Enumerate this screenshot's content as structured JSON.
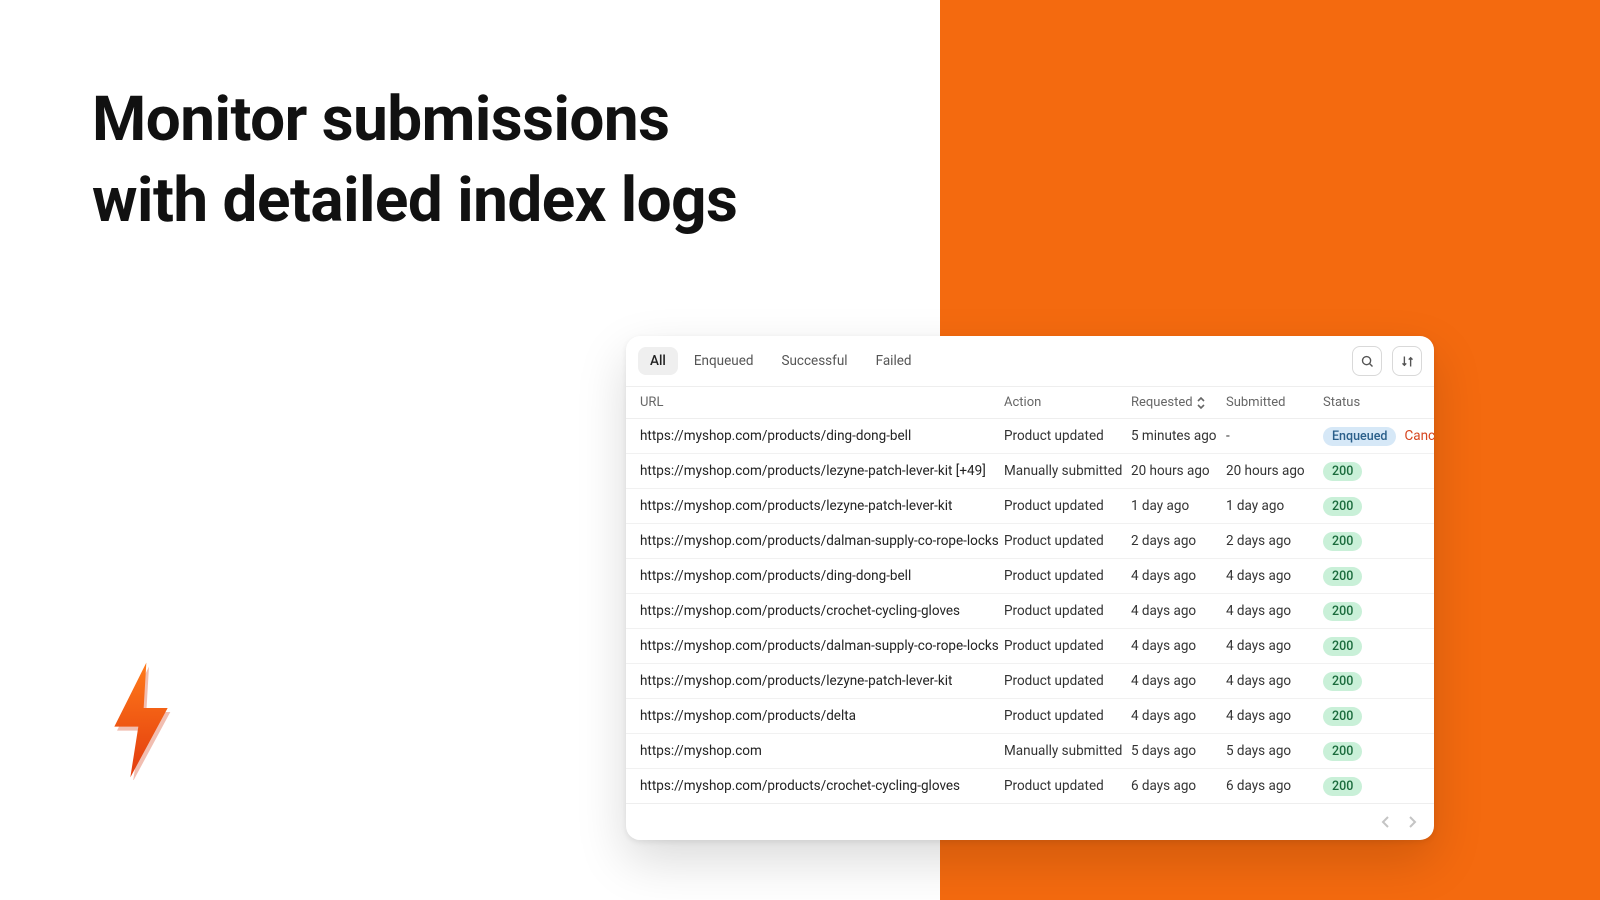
{
  "headline_line1": "Monitor submissions",
  "headline_line2": "with detailed index logs",
  "tabs": [
    "All",
    "Enqueued",
    "Successful",
    "Failed"
  ],
  "active_tab_index": 0,
  "columns": {
    "url": "URL",
    "action": "Action",
    "requested": "Requested",
    "submitted": "Submitted",
    "status": "Status"
  },
  "enqueued_label": "Enqueued",
  "cancel_label": "Cancel",
  "rows": [
    {
      "url": "https://myshop.com/products/ding-dong-bell",
      "action": "Product updated",
      "requested": "5 minutes ago",
      "submitted": "-",
      "status_type": "enqueued"
    },
    {
      "url": "https://myshop.com/products/lezyne-patch-lever-kit [+49]",
      "action": "Manually submitted",
      "requested": "20 hours ago",
      "submitted": "20 hours ago",
      "status_type": "200"
    },
    {
      "url": "https://myshop.com/products/lezyne-patch-lever-kit",
      "action": "Product updated",
      "requested": "1 day ago",
      "submitted": "1 day ago",
      "status_type": "200"
    },
    {
      "url": "https://myshop.com/products/dalman-supply-co-rope-locks",
      "action": "Product updated",
      "requested": "2 days ago",
      "submitted": "2 days ago",
      "status_type": "200"
    },
    {
      "url": "https://myshop.com/products/ding-dong-bell",
      "action": "Product updated",
      "requested": "4 days ago",
      "submitted": "4 days ago",
      "status_type": "200"
    },
    {
      "url": "https://myshop.com/products/crochet-cycling-gloves",
      "action": "Product updated",
      "requested": "4 days ago",
      "submitted": "4 days ago",
      "status_type": "200"
    },
    {
      "url": "https://myshop.com/products/dalman-supply-co-rope-locks",
      "action": "Product updated",
      "requested": "4 days ago",
      "submitted": "4 days ago",
      "status_type": "200"
    },
    {
      "url": "https://myshop.com/products/lezyne-patch-lever-kit",
      "action": "Product updated",
      "requested": "4 days ago",
      "submitted": "4 days ago",
      "status_type": "200"
    },
    {
      "url": "https://myshop.com/products/delta",
      "action": "Product updated",
      "requested": "4 days ago",
      "submitted": "4 days ago",
      "status_type": "200"
    },
    {
      "url": "https://myshop.com",
      "action": "Manually submitted",
      "requested": "5 days ago",
      "submitted": "5 days ago",
      "status_type": "200"
    },
    {
      "url": "https://myshop.com/products/crochet-cycling-gloves",
      "action": "Product updated",
      "requested": "6 days ago",
      "submitted": "6 days ago",
      "status_type": "200"
    }
  ]
}
